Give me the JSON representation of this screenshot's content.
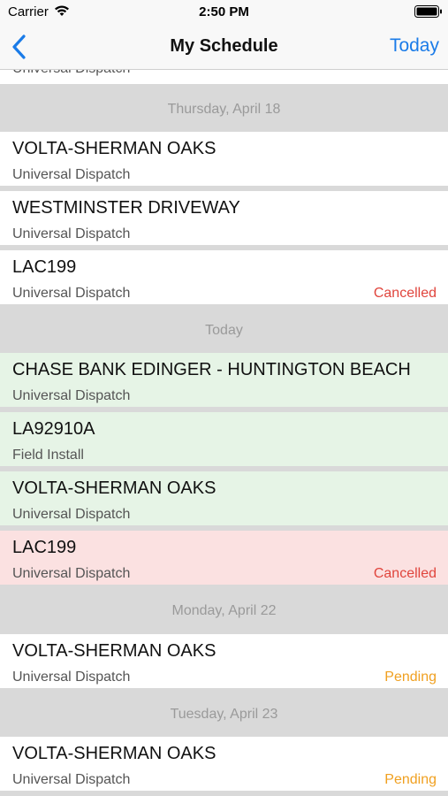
{
  "status_bar": {
    "carrier": "Carrier",
    "time": "2:50 PM"
  },
  "nav": {
    "title": "My Schedule",
    "today_label": "Today",
    "back_icon": "chevron-left-icon"
  },
  "colors": {
    "accent": "#1a7be8",
    "today_row": "#e6f4e6",
    "cancelled_row": "#fbe1e1",
    "cancelled_text": "#e0443c",
    "pending_text": "#f0a020"
  },
  "schedule": {
    "partial_row_subtitle": "Universal Dispatch",
    "sections": [
      {
        "header": "Thursday, April 18",
        "rows": [
          {
            "title": "VOLTA-SHERMAN OAKS",
            "subtitle": "Universal Dispatch",
            "status": ""
          },
          {
            "title": "WESTMINSTER DRIVEWAY",
            "subtitle": "Universal Dispatch",
            "status": ""
          },
          {
            "title": "LAC199",
            "subtitle": "Universal Dispatch",
            "status": "Cancelled"
          }
        ]
      },
      {
        "header": "Today",
        "rows": [
          {
            "title": "CHASE BANK EDINGER - HUNTINGTON BEACH",
            "subtitle": "Universal Dispatch",
            "status": ""
          },
          {
            "title": "LA92910A",
            "subtitle": "Field Install",
            "status": ""
          },
          {
            "title": "VOLTA-SHERMAN OAKS",
            "subtitle": "Universal Dispatch",
            "status": ""
          },
          {
            "title": "LAC199",
            "subtitle": "Universal Dispatch",
            "status": "Cancelled"
          }
        ]
      },
      {
        "header": "Monday, April 22",
        "rows": [
          {
            "title": "VOLTA-SHERMAN OAKS",
            "subtitle": "Universal Dispatch",
            "status": "Pending"
          }
        ]
      },
      {
        "header": "Tuesday, April 23",
        "rows": [
          {
            "title": "VOLTA-SHERMAN OAKS",
            "subtitle": "Universal Dispatch",
            "status": "Pending"
          }
        ]
      }
    ]
  }
}
